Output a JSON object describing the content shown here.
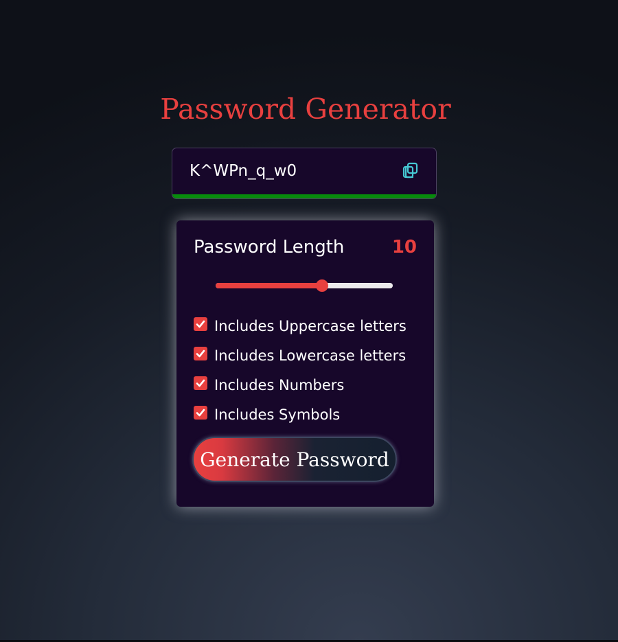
{
  "app": {
    "title": "Password Generator"
  },
  "display": {
    "password": "K^WPn_q_w0",
    "copy_icon": "copy-icon",
    "strength_color": "#078b0c"
  },
  "settings": {
    "length_label": "Password Length",
    "length_value": "10",
    "slider": {
      "fraction": 0.6
    },
    "options": [
      {
        "label": "Includes Uppercase letters",
        "checked": true
      },
      {
        "label": "Includes Lowercase letters",
        "checked": true
      },
      {
        "label": "Includes Numbers",
        "checked": true
      },
      {
        "label": "Includes Symbols",
        "checked": true
      }
    ],
    "generate_label": "Generate Password"
  },
  "colors": {
    "accent": "#e8403f",
    "panel": "#17072a",
    "copy_icon": "#46c9d4"
  }
}
